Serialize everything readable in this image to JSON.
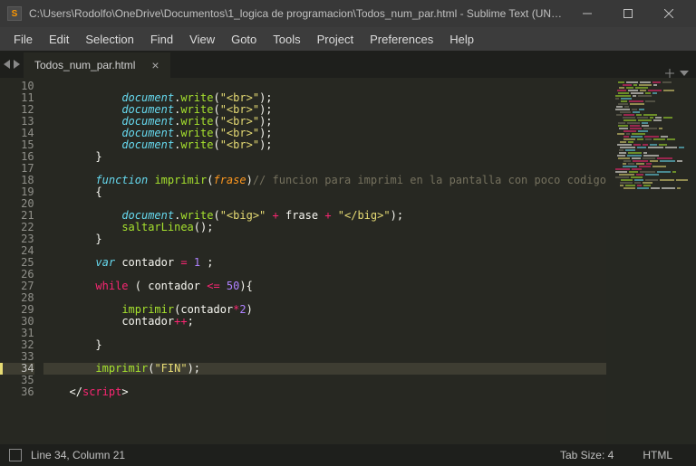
{
  "titlebar": {
    "app_icon_letter": "S",
    "title": "C:\\Users\\Rodolfo\\OneDrive\\Documentos\\1_logica de programacion\\Todos_num_par.html - Sublime Text (UNRE..."
  },
  "menu": {
    "file": "File",
    "edit": "Edit",
    "selection": "Selection",
    "find": "Find",
    "view": "View",
    "goto": "Goto",
    "tools": "Tools",
    "project": "Project",
    "preferences": "Preferences",
    "help": "Help"
  },
  "tab": {
    "name": "Todos_num_par.html",
    "close": "×"
  },
  "gutter": {
    "start": 10,
    "end": 36,
    "active": 34
  },
  "code": {
    "l10": {},
    "l11": {
      "obj": "document",
      "dot": ".",
      "method": "write",
      "lp": "(",
      "str": "\"<br>\"",
      "rp": ")",
      "semi": ";"
    },
    "l12": {
      "obj": "document",
      "dot": ".",
      "method": "write",
      "lp": "(",
      "str": "\"<br>\"",
      "rp": ")",
      "semi": ";"
    },
    "l13": {
      "obj": "document",
      "dot": ".",
      "method": "write",
      "lp": "(",
      "str": "\"<br>\"",
      "rp": ")",
      "semi": ";"
    },
    "l14": {
      "obj": "document",
      "dot": ".",
      "method": "write",
      "lp": "(",
      "str": "\"<br>\"",
      "rp": ")",
      "semi": ";"
    },
    "l15": {
      "obj": "document",
      "dot": ".",
      "method": "write",
      "lp": "(",
      "str": "\"<br>\"",
      "rp": ")",
      "semi": ";"
    },
    "l16": {
      "brace": "}"
    },
    "l18": {
      "kw": "function",
      "name": "imprimir",
      "lp": "(",
      "param": "frase",
      "rp": ")",
      "comment": "// funcion para imprimi en la pantalla con poco codigo"
    },
    "l19": {
      "brace": "{"
    },
    "l21": {
      "obj": "document",
      "dot": ".",
      "method": "write",
      "lp": "(",
      "s1": "\"<big>\"",
      "plus1": " + ",
      "var": "frase",
      "plus2": " + ",
      "s2": "\"</big>\"",
      "rp": ")",
      "semi": ";"
    },
    "l22": {
      "call": "saltarLinea",
      "lp": "(",
      "rp": ")",
      "semi": ";"
    },
    "l23": {
      "brace": "}"
    },
    "l25": {
      "kw": "var",
      "name": "contador",
      "eq": " = ",
      "num": "1",
      "semi": " ;"
    },
    "l27": {
      "kw": "while",
      "lp": " ( ",
      "var": "contador",
      "op": " <= ",
      "num": "50",
      "rp": ")",
      "brace": "{"
    },
    "l29": {
      "call": "imprimir",
      "lp": "(",
      "var": "contador",
      "op": "*",
      "num": "2",
      "rp": ")"
    },
    "l30": {
      "var": "contador",
      "op": "++",
      "semi": ";"
    },
    "l32": {
      "brace": "}"
    },
    "l34": {
      "call": "imprimir",
      "lp": "(",
      "str": "\"FIN\"",
      "rp": ")",
      "semi": ";"
    },
    "l36": {
      "lt": "</",
      "tag": "script",
      "gt": ">"
    }
  },
  "status": {
    "position": "Line 34, Column 21",
    "tabsize": "Tab Size: 4",
    "syntax": "HTML"
  }
}
